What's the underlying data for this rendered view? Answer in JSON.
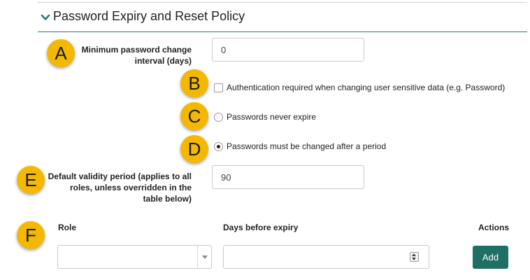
{
  "section": {
    "title": "Password Expiry and Reset Policy"
  },
  "colors": {
    "accent": "#2a7d74",
    "button": "#1f6f64",
    "badge": "#f5b800"
  },
  "badges": [
    "A",
    "B",
    "C",
    "D",
    "E",
    "F"
  ],
  "min_interval": {
    "label_line1": "Minimum password change",
    "label_line2": "interval (days)",
    "value": "0"
  },
  "auth_required": {
    "label": "Authentication required when changing user sensitive data (e.g. Password)",
    "checked": false
  },
  "never_expire": {
    "label": "Passwords never expire",
    "selected": false
  },
  "must_change": {
    "label": "Passwords must be changed after a period",
    "selected": true
  },
  "validity": {
    "label_line1": "Default validity period (applies to all",
    "label_line2": "roles, unless overridden in the",
    "label_line3": "table below)",
    "value": "90"
  },
  "table": {
    "col_role": "Role",
    "col_days": "Days before expiry",
    "col_actions": "Actions",
    "add_label": "Add",
    "role_value": "",
    "days_value": ""
  },
  "icons": {
    "header": "chevron-down-icon",
    "select": "dropdown-arrow-icon",
    "spinner": "spinner-icon"
  }
}
